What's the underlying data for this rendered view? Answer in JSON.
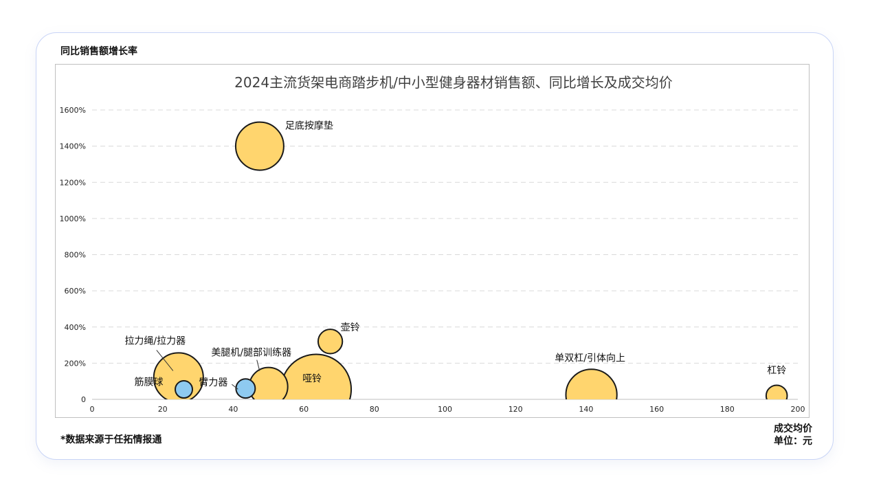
{
  "card": {
    "source_note": "*数据来源于任拓情报通"
  },
  "colors": {
    "card_border": "#C8D4F6",
    "frame_border": "#BFBFBF",
    "gridline": "#D9D9D9",
    "bubble_stroke": "#1A1A1A",
    "title_text": "#404040",
    "bubble_yellow": "#FFD56E",
    "bubble_blue": "#8ECAF0"
  },
  "chart_data": {
    "type": "scatter",
    "title": "2024主流货架电商踏步机/中小型健身器材销售额、同比增长及成交均价",
    "xlabel": "成交均价",
    "ylabel": "同比销售额增长率",
    "unit_label": "单位：元",
    "xlim": [
      0,
      200
    ],
    "ylim": [
      0,
      1600
    ],
    "grid": true,
    "x_ticks": [
      {
        "value": 0,
        "label": "0"
      },
      {
        "value": 20,
        "label": "20"
      },
      {
        "value": 40,
        "label": "40"
      },
      {
        "value": 60,
        "label": "60"
      },
      {
        "value": 80,
        "label": "80"
      },
      {
        "value": 100,
        "label": "100"
      },
      {
        "value": 120,
        "label": "120"
      },
      {
        "value": 140,
        "label": "140"
      },
      {
        "value": 160,
        "label": "160"
      },
      {
        "value": 180,
        "label": "180"
      },
      {
        "value": 200,
        "label": "200"
      }
    ],
    "y_ticks": [
      {
        "value": 0,
        "label": "0"
      },
      {
        "value": 200,
        "label": "200%"
      },
      {
        "value": 400,
        "label": "400%"
      },
      {
        "value": 600,
        "label": "600%"
      },
      {
        "value": 800,
        "label": "800%"
      },
      {
        "value": 1000,
        "label": "1000%"
      },
      {
        "value": 1200,
        "label": "1200%"
      },
      {
        "value": 1400,
        "label": "1400%"
      },
      {
        "value": 1600,
        "label": "1600%"
      }
    ],
    "points": [
      {
        "label": "哑铃",
        "x": 63.5,
        "y": 55,
        "size": 100,
        "color": "#FFD56E"
      },
      {
        "label": "单双杠/引体向上",
        "x": 141.5,
        "y": 25,
        "size": 53,
        "color": "#FFD56E"
      },
      {
        "label": "拉力绳/拉力器",
        "x": 24.5,
        "y": 120,
        "size": 50,
        "color": "#FFD56E"
      },
      {
        "label": "足底按摩垫",
        "x": 47.5,
        "y": 1400,
        "size": 47,
        "color": "#FFD56E"
      },
      {
        "label": "美腿机/腿部训练器",
        "x": 50,
        "y": 70,
        "size": 30,
        "color": "#FFD56E"
      },
      {
        "label": "壶铃",
        "x": 67.5,
        "y": 320,
        "size": 12,
        "color": "#FFD56E"
      },
      {
        "label": "杠铃",
        "x": 194,
        "y": 20,
        "size": 9,
        "color": "#FFD56E"
      },
      {
        "label": "臂力器",
        "x": 43.5,
        "y": 60,
        "size": 7.5,
        "color": "#8ECAF0"
      },
      {
        "label": "筋膜球",
        "x": 26,
        "y": 55,
        "size": 6,
        "color": "#8ECAF0"
      }
    ]
  }
}
